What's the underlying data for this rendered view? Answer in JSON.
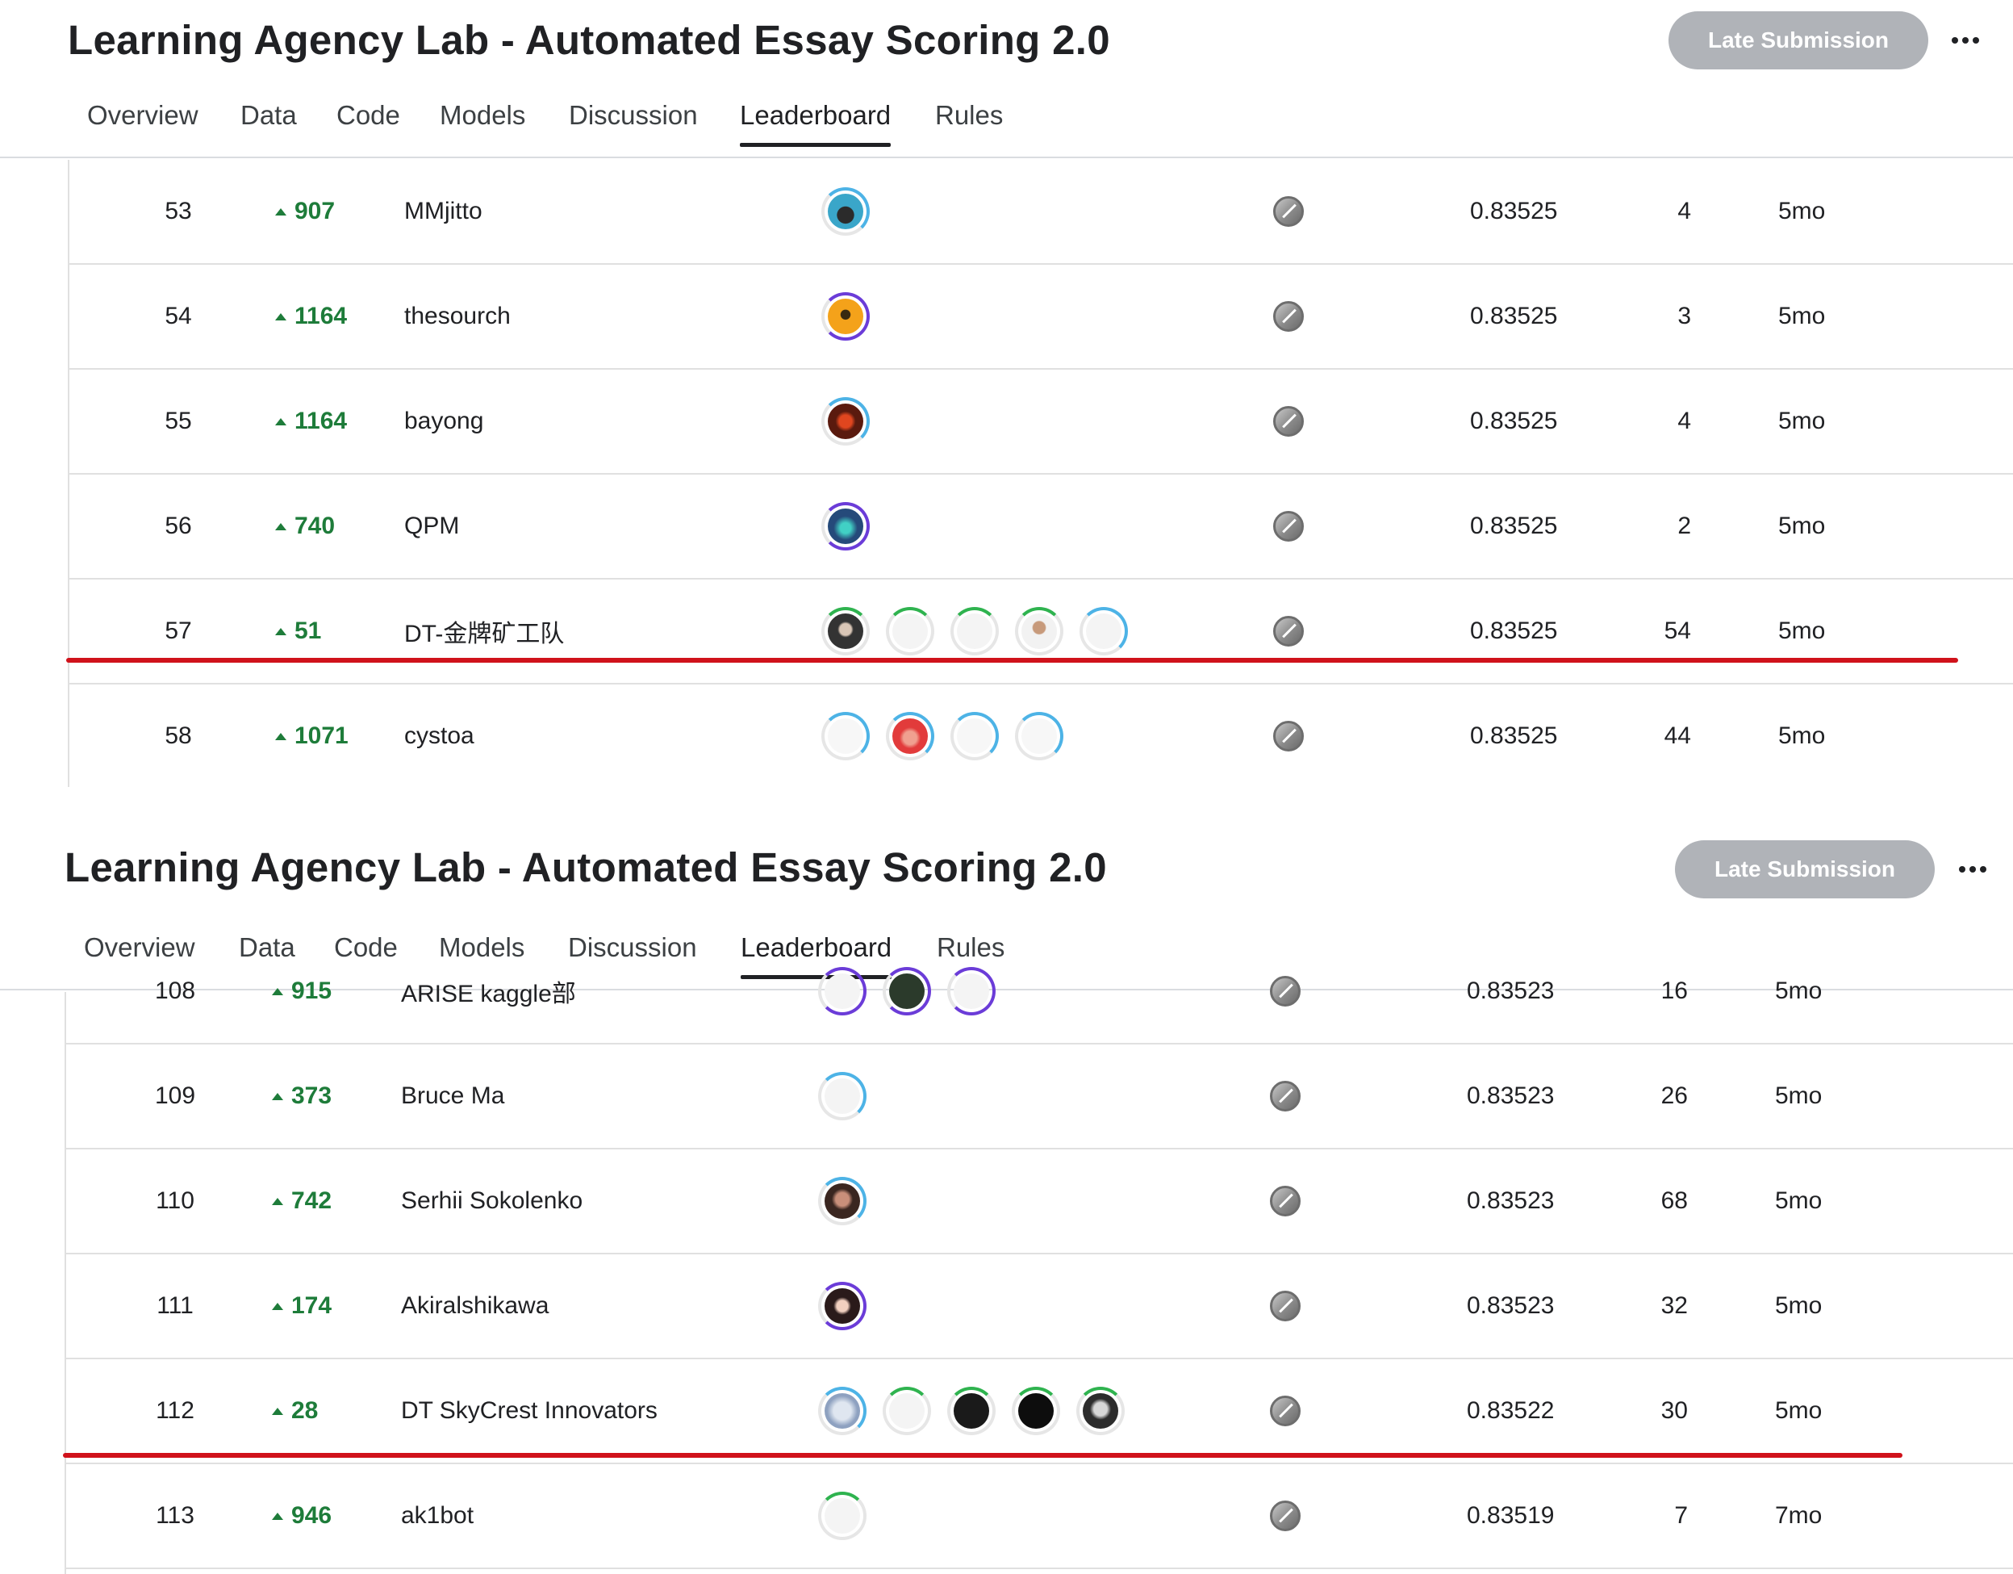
{
  "header": {
    "title": "Learning Agency Lab - Automated Essay Scoring 2.0",
    "late_submission_label": "Late Submission",
    "more_icon": "more-horizontal-icon"
  },
  "tabs": [
    {
      "label": "Overview",
      "active": false
    },
    {
      "label": "Data",
      "active": false
    },
    {
      "label": "Code",
      "active": false
    },
    {
      "label": "Models",
      "active": false
    },
    {
      "label": "Discussion",
      "active": false
    },
    {
      "label": "Leaderboard",
      "active": true
    },
    {
      "label": "Rules",
      "active": false
    }
  ],
  "colors": {
    "delta_green": "#1e7c3a",
    "highlight_red": "#d0121b",
    "button_gray": "#b0b3b8"
  },
  "panel1": {
    "rows": [
      {
        "rank": "53",
        "delta": "907",
        "team": "MMjitto",
        "score": "0.83525",
        "entries": "4",
        "last": "5mo"
      },
      {
        "rank": "54",
        "delta": "1164",
        "team": "thesourch",
        "score": "0.83525",
        "entries": "3",
        "last": "5mo"
      },
      {
        "rank": "55",
        "delta": "1164",
        "team": "bayong",
        "score": "0.83525",
        "entries": "4",
        "last": "5mo"
      },
      {
        "rank": "56",
        "delta": "740",
        "team": "QPM",
        "score": "0.83525",
        "entries": "2",
        "last": "5mo"
      },
      {
        "rank": "57",
        "delta": "51",
        "team": "DT-金牌矿工队",
        "score": "0.83525",
        "entries": "54",
        "last": "5mo"
      },
      {
        "rank": "58",
        "delta": "1071",
        "team": "cystoa",
        "score": "0.83525",
        "entries": "44",
        "last": "5mo"
      }
    ]
  },
  "panel2": {
    "rows": [
      {
        "rank": "108",
        "delta": "915",
        "team": "ARISE kaggle部",
        "score": "0.83523",
        "entries": "16",
        "last": "5mo"
      },
      {
        "rank": "109",
        "delta": "373",
        "team": "Bruce Ma",
        "score": "0.83523",
        "entries": "26",
        "last": "5mo"
      },
      {
        "rank": "110",
        "delta": "742",
        "team": "Serhii Sokolenko",
        "score": "0.83523",
        "entries": "68",
        "last": "5mo"
      },
      {
        "rank": "111",
        "delta": "174",
        "team": "Akiralshikawa",
        "score": "0.83523",
        "entries": "32",
        "last": "5mo"
      },
      {
        "rank": "112",
        "delta": "28",
        "team": "DT SkyCrest Innovators",
        "score": "0.83522",
        "entries": "30",
        "last": "5mo"
      },
      {
        "rank": "113",
        "delta": "946",
        "team": "ak1bot",
        "score": "0.83519",
        "entries": "7",
        "last": "7mo"
      }
    ]
  }
}
